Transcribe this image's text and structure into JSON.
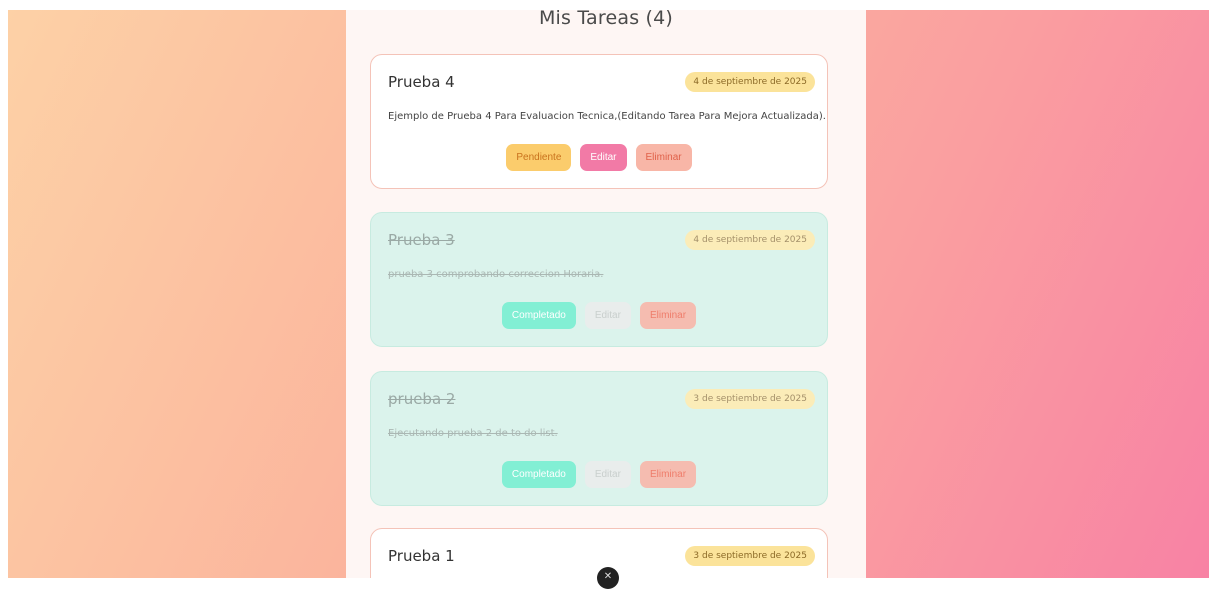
{
  "header": {
    "title": "Mis Tareas (4)"
  },
  "tasks": [
    {
      "title": "Prueba 4",
      "date": "4 de septiembre de 2025",
      "description": "Ejemplo de Prueba 4 Para Evaluacion Tecnica,(Editando Tarea Para Mejora Actualizada).",
      "status_label": "Pendiente",
      "edit_label": "Editar",
      "delete_label": "Eliminar",
      "completed": false
    },
    {
      "title": "Prueba 3",
      "date": "4 de septiembre de 2025",
      "description": "prueba 3 comprobando correccion Horaria.",
      "status_label": "Completado",
      "edit_label": "Editar",
      "delete_label": "Eliminar",
      "completed": true
    },
    {
      "title": "prueba 2",
      "date": "3 de septiembre de 2025",
      "description": "Ejecutando prueba 2 de to do list.",
      "status_label": "Completado",
      "edit_label": "Editar",
      "delete_label": "Eliminar",
      "completed": true
    },
    {
      "title": "Prueba 1",
      "date": "3 de septiembre de 2025",
      "completed": false
    }
  ],
  "floating_close": {
    "icon": "close-icon",
    "glyph": "✕"
  },
  "colors": {
    "background_start": "#fdd1a6",
    "background_end": "#f882a4",
    "pending_badge": "#fbcc6c",
    "edit_button": "#f27aa6",
    "delete_button": "#f8b6a7",
    "completed_badge": "#82efd4",
    "completed_card": "#dbf3ec"
  }
}
